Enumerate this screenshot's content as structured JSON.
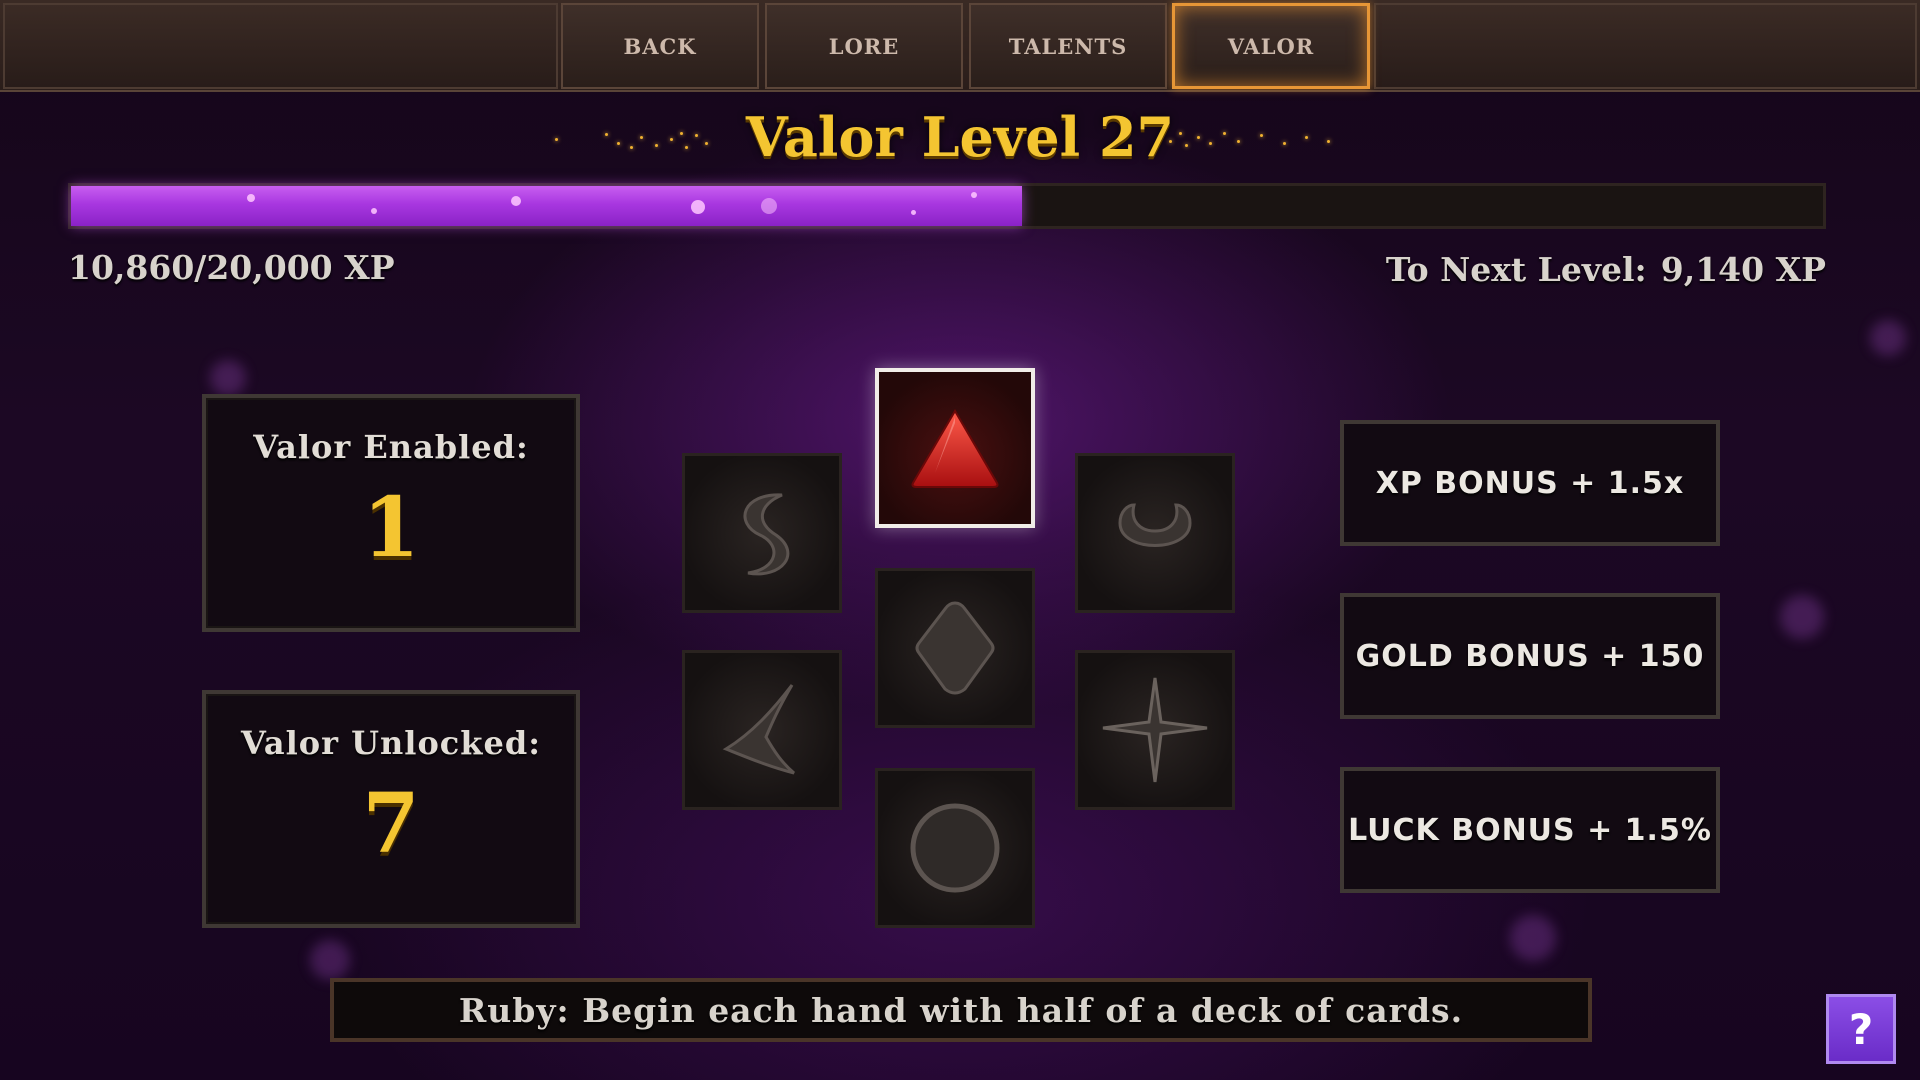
{
  "nav": {
    "tabs": [
      {
        "label": "BACK",
        "active": false
      },
      {
        "label": "LORE",
        "active": false
      },
      {
        "label": "TALENTS",
        "active": false
      },
      {
        "label": "VALOR",
        "active": true
      }
    ],
    "active_color": "#e79636"
  },
  "header": {
    "title": "Valor Level 27"
  },
  "progress": {
    "fraction": 0.543,
    "xp_text": "10,860/20,000 XP",
    "to_next_label": "To Next Level:",
    "to_next_value": "9,140 XP",
    "fill_color": "#a837e0"
  },
  "stats": {
    "enabled": {
      "label": "Valor Enabled:",
      "value": "1"
    },
    "unlocked": {
      "label": "Valor Unlocked:",
      "value": "7"
    }
  },
  "gems": [
    {
      "name": "ruby",
      "shape": "triangle-icon",
      "selected": true,
      "color": "#d62020"
    },
    {
      "name": "s-curve",
      "shape": "s-curve-icon",
      "selected": false
    },
    {
      "name": "crescent",
      "shape": "crescent-icon",
      "selected": false
    },
    {
      "name": "diamond",
      "shape": "diamond-icon",
      "selected": false
    },
    {
      "name": "chevron",
      "shape": "chevron-icon",
      "selected": false
    },
    {
      "name": "star",
      "shape": "four-point-star-icon",
      "selected": false
    },
    {
      "name": "circle",
      "shape": "circle-icon",
      "selected": false
    }
  ],
  "bonuses": [
    {
      "label": "XP BONUS + 1.5x"
    },
    {
      "label": "GOLD BONUS + 150"
    },
    {
      "label": "LUCK BONUS + 1.5%"
    }
  ],
  "description": "Ruby: Begin each hand with half of a deck of cards.",
  "help": {
    "label": "?"
  },
  "colors": {
    "gold": "#f4c531",
    "background": "#1c0824"
  }
}
